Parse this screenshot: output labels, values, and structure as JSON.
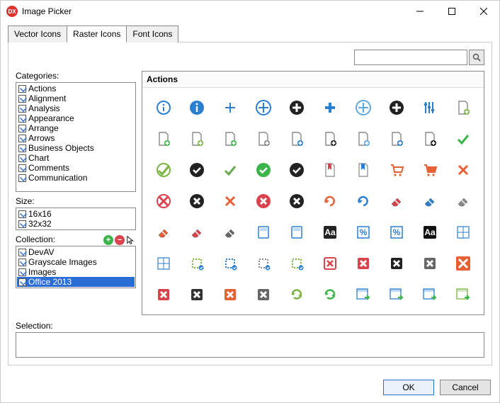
{
  "window": {
    "title": "Image Picker",
    "app_icon_text": "DX"
  },
  "tabs": {
    "vector": "Vector Icons",
    "raster": "Raster Icons",
    "font": "Font Icons",
    "active": "raster"
  },
  "search": {
    "placeholder": ""
  },
  "labels": {
    "categories": "Categories:",
    "size": "Size:",
    "collection": "Collection:",
    "selection": "Selection:"
  },
  "categories": [
    "Actions",
    "Alignment",
    "Analysis",
    "Appearance",
    "Arrange",
    "Arrows",
    "Business Objects",
    "Chart",
    "Comments",
    "Communication"
  ],
  "sizes": [
    "16x16",
    "32x32"
  ],
  "collections": [
    {
      "name": "DevAV",
      "selected": false
    },
    {
      "name": "Grayscale Images",
      "selected": false
    },
    {
      "name": "Images",
      "selected": false
    },
    {
      "name": "Office 2013",
      "selected": true
    }
  ],
  "grid": {
    "header": "Actions"
  },
  "buttons": {
    "ok": "OK",
    "cancel": "Cancel"
  },
  "icons": [
    {
      "k": "info",
      "c": "#2b7fd1",
      "t": "outline"
    },
    {
      "k": "info",
      "c": "#2b7fd1",
      "t": "fill"
    },
    {
      "k": "plus",
      "c": "#2b7fd1",
      "t": "thin"
    },
    {
      "k": "plus",
      "c": "#2b7fd1",
      "t": "circle"
    },
    {
      "k": "plus",
      "c": "#222",
      "t": "circlef"
    },
    {
      "k": "plus",
      "c": "#2b7fd1",
      "t": "bold"
    },
    {
      "k": "plus",
      "c": "#5fa8e0",
      "t": "glow"
    },
    {
      "k": "plus",
      "c": "#222",
      "t": "big"
    },
    {
      "k": "equalizer",
      "c": "#2b7fd1",
      "t": "lines"
    },
    {
      "k": "docadd",
      "c": "#7cb342",
      "t": "small"
    },
    {
      "k": "docadd",
      "c": "#3bb54a",
      "t": "badge"
    },
    {
      "k": "docadd",
      "c": "#7cb342",
      "t": "plain"
    },
    {
      "k": "docadd",
      "c": "#3bb54a",
      "t": "green"
    },
    {
      "k": "docadd",
      "c": "#888",
      "t": "gray"
    },
    {
      "k": "docadd",
      "c": "#2b7fd1",
      "t": "blue"
    },
    {
      "k": "docadd",
      "c": "#222",
      "t": "dark"
    },
    {
      "k": "docadd",
      "c": "#5fa8e0",
      "t": "open"
    },
    {
      "k": "docadd",
      "c": "#2b7fd1",
      "t": "bold"
    },
    {
      "k": "docadd",
      "c": "#111",
      "t": "black"
    },
    {
      "k": "check",
      "c": "#3bb54a",
      "t": "thin"
    },
    {
      "k": "check",
      "c": "#7cb342",
      "t": "circle"
    },
    {
      "k": "check",
      "c": "#222",
      "t": "circlef"
    },
    {
      "k": "check",
      "c": "#6aa84f",
      "t": "plain"
    },
    {
      "k": "check",
      "c": "#3bb54a",
      "t": "glow"
    },
    {
      "k": "check",
      "c": "#222",
      "t": "big"
    },
    {
      "k": "bookmark",
      "c": "#d9434e",
      "t": "doc"
    },
    {
      "k": "bookmark",
      "c": "#2b7fd1",
      "t": "big"
    },
    {
      "k": "cart",
      "c": "#e76034",
      "t": "line"
    },
    {
      "k": "cart",
      "c": "#e76034",
      "t": "fill"
    },
    {
      "k": "x",
      "c": "#e76034",
      "t": "thin"
    },
    {
      "k": "x",
      "c": "#d9434e",
      "t": "circle"
    },
    {
      "k": "x",
      "c": "#222",
      "t": "circlef"
    },
    {
      "k": "x",
      "c": "#e76034",
      "t": "plain"
    },
    {
      "k": "x",
      "c": "#d9434e",
      "t": "glow"
    },
    {
      "k": "x",
      "c": "#222",
      "t": "big"
    },
    {
      "k": "redo",
      "c": "#e76034",
      "t": "arrow"
    },
    {
      "k": "redo",
      "c": "#2b7fd1",
      "t": "arrow"
    },
    {
      "k": "eraser",
      "c": "#d9434e",
      "t": "a"
    },
    {
      "k": "eraser",
      "c": "#2b7fd1",
      "t": "a"
    },
    {
      "k": "eraser",
      "c": "#888",
      "t": "a"
    },
    {
      "k": "eraser",
      "c": "#e76034",
      "t": "b"
    },
    {
      "k": "eraser",
      "c": "#d9434e",
      "t": "b"
    },
    {
      "k": "eraser",
      "c": "#666",
      "t": "b"
    },
    {
      "k": "calc",
      "c": "#2b7fd1",
      "t": "a"
    },
    {
      "k": "calc",
      "c": "#2b7fd1",
      "t": "b"
    },
    {
      "k": "aa",
      "c": "#222",
      "t": "badge"
    },
    {
      "k": "pct",
      "c": "#2b7fd1",
      "t": "a"
    },
    {
      "k": "pct",
      "c": "#2b7fd1",
      "t": "b"
    },
    {
      "k": "aa",
      "c": "#111",
      "t": "block"
    },
    {
      "k": "grid",
      "c": "#2b7fd1",
      "t": "a"
    },
    {
      "k": "grid",
      "c": "#2b7fd1",
      "t": "er"
    },
    {
      "k": "crop",
      "c": "#7cb342",
      "t": "a"
    },
    {
      "k": "crop",
      "c": "#2b7fd1",
      "t": "a"
    },
    {
      "k": "crop",
      "c": "#888",
      "t": "a"
    },
    {
      "k": "crop",
      "c": "#7cb342",
      "t": "b"
    },
    {
      "k": "xbox",
      "c": "#d9434e",
      "t": "o"
    },
    {
      "k": "xbox",
      "c": "#d9434e",
      "t": "f"
    },
    {
      "k": "xbox",
      "c": "#222",
      "t": "f"
    },
    {
      "k": "xbox",
      "c": "#666",
      "t": "f"
    },
    {
      "k": "xbox",
      "c": "#e76034",
      "t": "big"
    },
    {
      "k": "xbox",
      "c": "#d9434e",
      "t": "sq"
    },
    {
      "k": "xbox",
      "c": "#333",
      "t": "sq"
    },
    {
      "k": "xbox",
      "c": "#e76034",
      "t": "sq"
    },
    {
      "k": "xbox",
      "c": "#666",
      "t": "sq"
    },
    {
      "k": "refresh",
      "c": "#7cb342",
      "t": "a"
    },
    {
      "k": "refresh",
      "c": "#3bb54a",
      "t": "glow"
    },
    {
      "k": "tablego",
      "c": "#2b7fd1",
      "t": "a"
    },
    {
      "k": "tablego",
      "c": "#2b7fd1",
      "t": "b"
    },
    {
      "k": "tablego",
      "c": "#2b7fd1",
      "t": "big"
    },
    {
      "k": "tablego",
      "c": "#7cb342",
      "t": "a"
    }
  ]
}
